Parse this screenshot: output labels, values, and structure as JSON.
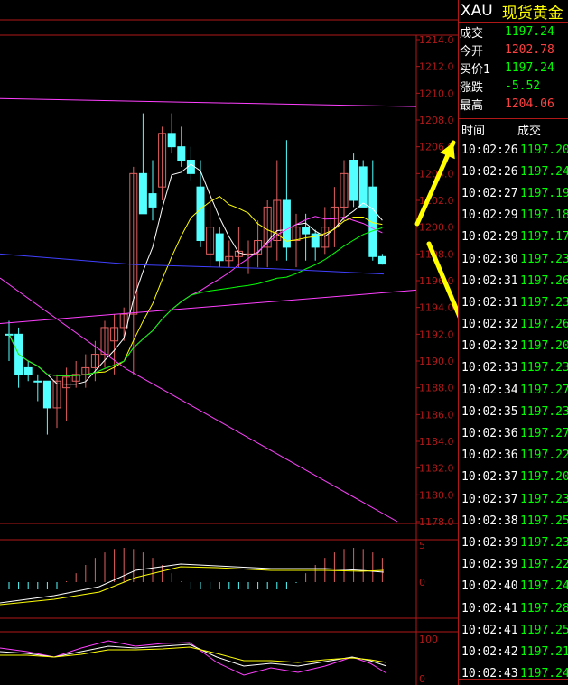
{
  "symbol": {
    "code": "XAU",
    "name": "现货黄金"
  },
  "quote": [
    {
      "label": "成交",
      "value": "1197.24",
      "color": "#00ff00"
    },
    {
      "label": "今开",
      "value": "1202.78",
      "color": "#ff4040"
    },
    {
      "label": "买价1",
      "value": "1197.24",
      "color": "#00ff00"
    },
    {
      "label": "涨跌",
      "value": "-5.52",
      "color": "#00ff00"
    },
    {
      "label": "最高",
      "value": "1204.06",
      "color": "#ff4040"
    }
  ],
  "tick_headers": {
    "time": "时间",
    "price": "成交"
  },
  "ticks": [
    {
      "time": "10:02:26",
      "price": "1197.20"
    },
    {
      "time": "10:02:26",
      "price": "1197.24"
    },
    {
      "time": "10:02:27",
      "price": "1197.19"
    },
    {
      "time": "10:02:29",
      "price": "1197.18"
    },
    {
      "time": "10:02:29",
      "price": "1197.17"
    },
    {
      "time": "10:02:30",
      "price": "1197.23"
    },
    {
      "time": "10:02:31",
      "price": "1197.26"
    },
    {
      "time": "10:02:31",
      "price": "1197.23"
    },
    {
      "time": "10:02:32",
      "price": "1197.26"
    },
    {
      "time": "10:02:32",
      "price": "1197.20"
    },
    {
      "time": "10:02:33",
      "price": "1197.23"
    },
    {
      "time": "10:02:34",
      "price": "1197.27"
    },
    {
      "time": "10:02:35",
      "price": "1197.23"
    },
    {
      "time": "10:02:36",
      "price": "1197.27"
    },
    {
      "time": "10:02:36",
      "price": "1197.22"
    },
    {
      "time": "10:02:37",
      "price": "1197.20"
    },
    {
      "time": "10:02:37",
      "price": "1197.23"
    },
    {
      "time": "10:02:38",
      "price": "1197.25"
    },
    {
      "time": "10:02:39",
      "price": "1197.23"
    },
    {
      "time": "10:02:39",
      "price": "1197.22"
    },
    {
      "time": "10:02:40",
      "price": "1197.24"
    },
    {
      "time": "10:02:41",
      "price": "1197.28"
    },
    {
      "time": "10:02:41",
      "price": "1197.25"
    },
    {
      "time": "10:02:42",
      "price": "1197.21"
    },
    {
      "time": "10:02:43",
      "price": "1197.24"
    }
  ],
  "chart_data": {
    "type": "candlestick",
    "y_ticks": [
      "1214.0",
      "1212.0",
      "1210.0",
      "1208.0",
      "1206.0",
      "1204.0",
      "1202.0",
      "1200.0",
      "1198.0",
      "1196.0",
      "1194.0",
      "1192.0",
      "1190.0",
      "1188.0",
      "1186.0",
      "1184.0",
      "1182.0",
      "1180.0",
      "1178.0"
    ],
    "ylim": [
      1178,
      1214
    ],
    "candles": [
      {
        "o": 1192,
        "h": 1193,
        "l": 1190,
        "c": 1192,
        "up": false
      },
      {
        "o": 1192,
        "h": 1192.5,
        "l": 1188,
        "c": 1189,
        "up": false
      },
      {
        "o": 1189.5,
        "h": 1190,
        "l": 1188.5,
        "c": 1189,
        "up": false
      },
      {
        "o": 1188.5,
        "h": 1189,
        "l": 1187,
        "c": 1188.5,
        "up": false
      },
      {
        "o": 1188.5,
        "h": 1188.5,
        "l": 1184.5,
        "c": 1186.5,
        "up": false
      },
      {
        "o": 1186.5,
        "h": 1189,
        "l": 1185,
        "c": 1188.5,
        "up": true
      },
      {
        "o": 1188,
        "h": 1189.5,
        "l": 1185.5,
        "c": 1188.8,
        "up": true
      },
      {
        "o": 1188.5,
        "h": 1190,
        "l": 1188,
        "c": 1189,
        "up": true
      },
      {
        "o": 1189,
        "h": 1190.5,
        "l": 1188,
        "c": 1189.5,
        "up": true
      },
      {
        "o": 1189.5,
        "h": 1191.5,
        "l": 1188.5,
        "c": 1190.5,
        "up": true
      },
      {
        "o": 1190.5,
        "h": 1193,
        "l": 1189.5,
        "c": 1192.5,
        "up": true
      },
      {
        "o": 1191.5,
        "h": 1193.5,
        "l": 1189,
        "c": 1192.5,
        "up": true
      },
      {
        "o": 1192.5,
        "h": 1194,
        "l": 1191.5,
        "c": 1193.5,
        "up": true
      },
      {
        "o": 1193.5,
        "h": 1204.5,
        "l": 1189,
        "c": 1204,
        "up": true
      },
      {
        "o": 1204,
        "h": 1208.5,
        "l": 1201,
        "c": 1201,
        "up": false
      },
      {
        "o": 1202.5,
        "h": 1205,
        "l": 1200.5,
        "c": 1201.5,
        "up": false
      },
      {
        "o": 1203,
        "h": 1207.5,
        "l": 1202,
        "c": 1207,
        "up": true
      },
      {
        "o": 1207,
        "h": 1208.5,
        "l": 1205.5,
        "c": 1206,
        "up": false
      },
      {
        "o": 1206,
        "h": 1207.5,
        "l": 1204.5,
        "c": 1205,
        "up": false
      },
      {
        "o": 1205,
        "h": 1206,
        "l": 1203.5,
        "c": 1204,
        "up": false
      },
      {
        "o": 1203,
        "h": 1205,
        "l": 1198.5,
        "c": 1199,
        "up": false
      },
      {
        "o": 1200,
        "h": 1202.5,
        "l": 1197,
        "c": 1198,
        "up": true
      },
      {
        "o": 1199.5,
        "h": 1200,
        "l": 1197,
        "c": 1197.5,
        "up": false
      },
      {
        "o": 1197.5,
        "h": 1199,
        "l": 1197,
        "c": 1197.8,
        "up": true
      },
      {
        "o": 1197.8,
        "h": 1200,
        "l": 1197,
        "c": 1198.2,
        "up": true
      },
      {
        "o": 1198,
        "h": 1199,
        "l": 1196.5,
        "c": 1198,
        "up": true
      },
      {
        "o": 1198,
        "h": 1200.5,
        "l": 1197,
        "c": 1199,
        "up": true
      },
      {
        "o": 1198.5,
        "h": 1202,
        "l": 1197,
        "c": 1201.5,
        "up": true
      },
      {
        "o": 1199,
        "h": 1205,
        "l": 1197.5,
        "c": 1202,
        "up": true
      },
      {
        "o": 1202,
        "h": 1206.5,
        "l": 1197.5,
        "c": 1198.5,
        "up": false
      },
      {
        "o": 1199,
        "h": 1201,
        "l": 1197,
        "c": 1200,
        "up": true
      },
      {
        "o": 1200,
        "h": 1201,
        "l": 1197.5,
        "c": 1199.5,
        "up": false
      },
      {
        "o": 1199.5,
        "h": 1199.8,
        "l": 1197.5,
        "c": 1198.5,
        "up": false
      },
      {
        "o": 1198.5,
        "h": 1201.5,
        "l": 1198,
        "c": 1200,
        "up": true
      },
      {
        "o": 1200,
        "h": 1203,
        "l": 1198.5,
        "c": 1201.5,
        "up": true
      },
      {
        "o": 1201.5,
        "h": 1205,
        "l": 1200.5,
        "c": 1204,
        "up": true
      },
      {
        "o": 1205,
        "h": 1205.5,
        "l": 1201.5,
        "c": 1202,
        "up": false
      },
      {
        "o": 1204.5,
        "h": 1205,
        "l": 1201.5,
        "c": 1201.5,
        "up": false
      },
      {
        "o": 1203,
        "h": 1205,
        "l": 1197.5,
        "c": 1197.8,
        "up": false
      },
      {
        "o": 1197.8,
        "h": 1198,
        "l": 1197.2,
        "c": 1197.24,
        "up": false
      }
    ]
  },
  "macd": {
    "y_ticks": [
      "5",
      "0"
    ]
  },
  "kdj": {
    "y_ticks": [
      "100",
      "0"
    ]
  },
  "colors": {
    "up": "#e06060",
    "down": "#54ffff",
    "grid": "#b01818",
    "axis_text": "#b01818",
    "ma_white": "#ffffff",
    "ma_yellow": "#ffff00",
    "ma_magenta": "#ff40ff",
    "ma_green": "#00ff00",
    "ma_blue": "#4040ff",
    "arrow": "#ffff00"
  }
}
